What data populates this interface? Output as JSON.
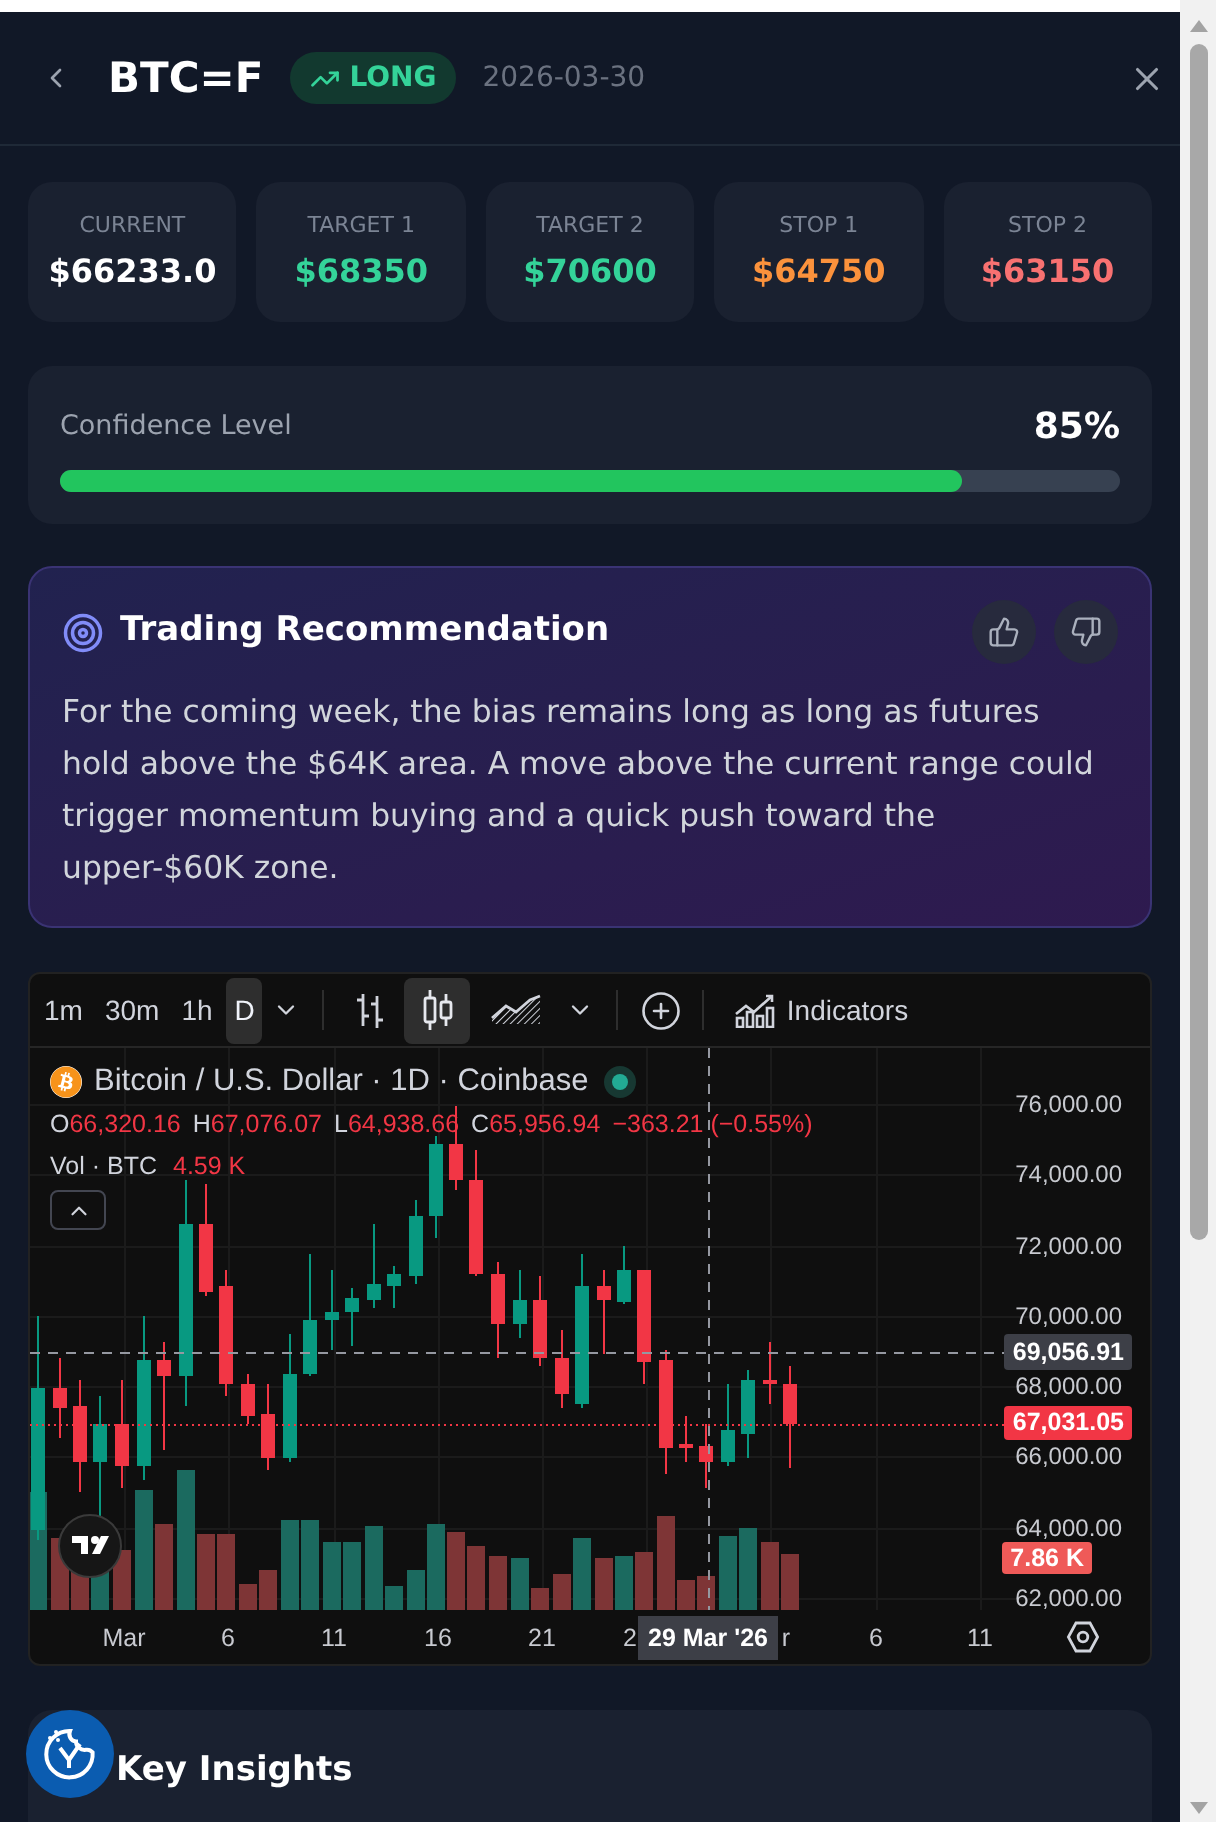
{
  "header": {
    "title": "BTC=F",
    "badge": {
      "kind": "long",
      "label": "LONG"
    },
    "date": "2026-03-30"
  },
  "stats": [
    {
      "label": "CURRENT",
      "value": "$66233.0",
      "color": "#ffffff"
    },
    {
      "label": "TARGET 1",
      "value": "$68350",
      "color": "#34d399"
    },
    {
      "label": "TARGET 2",
      "value": "$70600",
      "color": "#34d399"
    },
    {
      "label": "STOP 1",
      "value": "$64750",
      "color": "#fb923c"
    },
    {
      "label": "STOP 2",
      "value": "$63150",
      "color": "#f87171"
    }
  ],
  "confidence": {
    "label": "Confidence Level",
    "reading": "85%",
    "level": 0.85
  },
  "recommendation": {
    "title": "Trading Recommendation",
    "text": "For the coming week, the bias remains long as long as futures hold above the $64K area. A move above the current range could trigger momentum buying and a quick push toward the upper-$60K zone."
  },
  "chart": {
    "toolbar": {
      "intervals": [
        {
          "label": "1m",
          "selected": false
        },
        {
          "label": "30m",
          "selected": false
        },
        {
          "label": "1h",
          "selected": false
        },
        {
          "label": "D",
          "selected": true
        }
      ],
      "chart_types": [
        {
          "kind": "bars",
          "selected": false
        },
        {
          "kind": "candles",
          "selected": true
        },
        {
          "kind": "area",
          "selected": false
        }
      ],
      "indicators": "Indicators"
    },
    "legend": {
      "symbol": "Bitcoin / U.S. Dollar · 1D · Coinbase",
      "ohlc": [
        {
          "label": "O",
          "value": "66,320.16"
        },
        {
          "label": "H",
          "value": "67,076.07"
        },
        {
          "label": "L",
          "value": "64,938.66"
        },
        {
          "label": "C",
          "value": "65,956.94"
        }
      ],
      "change": "−363.21 (−0.55%)",
      "volume_label": "Vol · BTC",
      "volume": "4.59 K"
    },
    "price_axis": [
      "76,000.00",
      "74,000.00",
      "72,000.00",
      "70,000.00",
      "68,000.00",
      "66,000.00",
      "64,000.00",
      "62,000.00"
    ],
    "price_tags": [
      {
        "kind": "crosshair",
        "label": "69,056.91"
      },
      {
        "kind": "last",
        "label": "67,031.05"
      },
      {
        "kind": "volume",
        "label": "7.86 K"
      }
    ],
    "time_axis": [
      "Mar",
      "6",
      "11",
      "16",
      "21",
      "2",
      "r",
      "6",
      "11"
    ],
    "crosshair_date": "29 Mar '26"
  },
  "key_insights": {
    "title": "Key Insights"
  }
}
